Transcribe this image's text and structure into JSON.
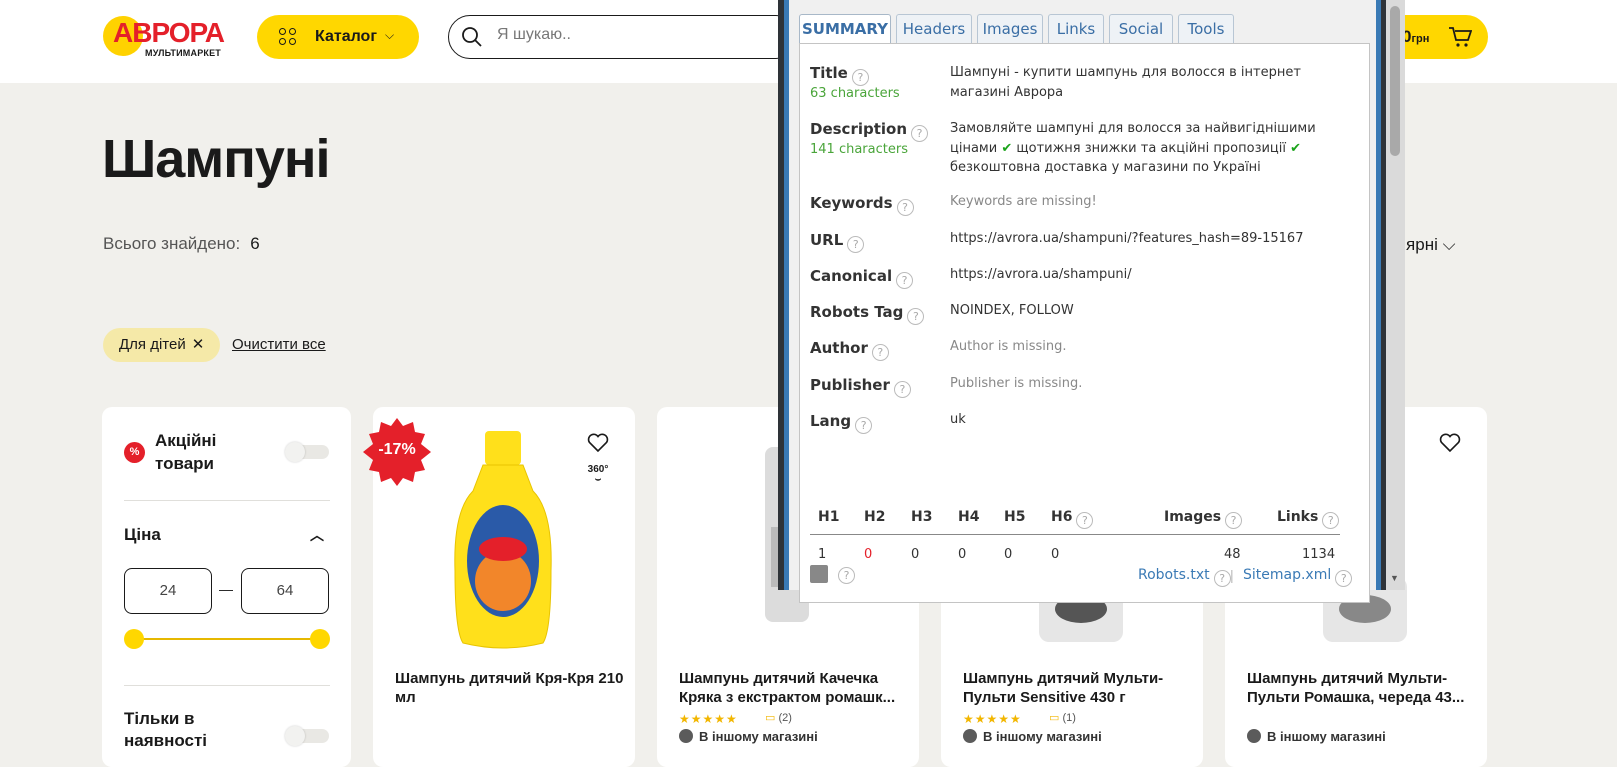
{
  "header": {
    "logo_text": "АВРОРА",
    "logo_sub": "МУЛЬТИМАРКЕТ",
    "catalog_label": "Каталог",
    "search_placeholder": "Я шукаю..",
    "cart_amount": "0",
    "cart_currency": "грн"
  },
  "page": {
    "title": "Шампуні",
    "found_label": "Всього знайдено:",
    "found_count": "6",
    "sort_label": "улярні",
    "active_filter": "Для дітей",
    "clear_all": "Очистити все"
  },
  "filters": {
    "promo_label": "Акційні товари",
    "promo_badge": "%",
    "price_label": "Ціна",
    "price_min": "24",
    "price_max": "64",
    "price_dash": "—",
    "stock_label": "Тільки в наявності"
  },
  "products": [
    {
      "name": "Шампунь дитячий Кря-Кря 210 мл",
      "discount": "-17%",
      "badge_360": "360°"
    },
    {
      "name": "Шампунь дитячий Качечка Кряка з екстрактом ромашк...",
      "stars": "★★★★★",
      "reviews": "(2)",
      "availability": "В іншому магазині"
    },
    {
      "name": "Шампунь дитячий Мульти-Пульти Sensitive 430 г",
      "stars": "★★★★★",
      "reviews": "(1)",
      "availability": "В іншому магазині"
    },
    {
      "name": "Шампунь дитячий Мульти-Пульти Ромашка, череда 43...",
      "availability": "В іншому магазині"
    }
  ],
  "seo": {
    "tabs": [
      "SUMMARY",
      "Headers",
      "Images",
      "Links",
      "Social",
      "Tools"
    ],
    "title_label": "Title",
    "title_count": "63 characters",
    "title_value": "Шампуні - купити шампунь для волосся в інтернет магазині Аврора",
    "desc_label": "Description",
    "desc_count": "141 characters",
    "desc_value_1": "Замовляйте шампуні для волосся за найвигіднішими цінами",
    "desc_value_2": "щотижня знижки та акційні пропозиції",
    "desc_value_3": "безкоштовна доставка у магазини по Україні",
    "tick": "✔",
    "keywords_label": "Keywords",
    "keywords_value": "Keywords are missing!",
    "url_label": "URL",
    "url_value": "https://avrora.ua/shampuni/?features_hash=89-15167",
    "canonical_label": "Canonical",
    "canonical_value": "https://avrora.ua/shampuni/",
    "robots_label": "Robots Tag",
    "robots_value": "NOINDEX, FOLLOW",
    "author_label": "Author",
    "author_value": "Author is missing.",
    "publisher_label": "Publisher",
    "publisher_value": "Publisher is missing.",
    "lang_label": "Lang",
    "lang_value": "uk",
    "help": "?",
    "headings": [
      "H1",
      "H2",
      "H3",
      "H4",
      "H5",
      "H6"
    ],
    "heading_counts": [
      "1",
      "0",
      "0",
      "0",
      "0",
      "0"
    ],
    "images_label": "Images",
    "images_count": "48",
    "links_label": "Links",
    "links_count": "1134",
    "robots_txt": "Robots.txt",
    "sitemap": "Sitemap.xml",
    "pipe": "|"
  },
  "colors": {
    "accent": "#ffd700",
    "brand_red": "#e4202a",
    "seo_blue": "#3a7ab5"
  }
}
